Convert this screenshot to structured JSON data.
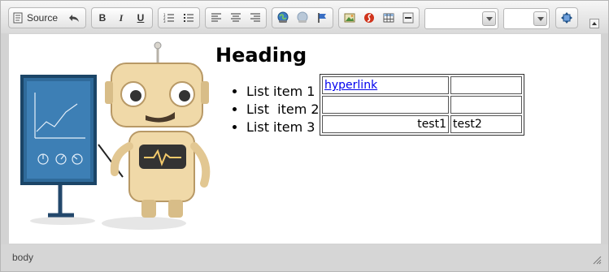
{
  "toolbar": {
    "source_label": "Source",
    "groups": [
      {
        "name": "document",
        "items": [
          "source-icon",
          "undo-icon"
        ]
      },
      {
        "name": "basic-styles",
        "items": [
          "bold-icon",
          "italic-icon",
          "underline-icon"
        ]
      },
      {
        "name": "lists",
        "items": [
          "numbered-list-icon",
          "bulleted-list-icon"
        ]
      },
      {
        "name": "align",
        "items": [
          "align-left-icon",
          "align-center-icon",
          "align-right-icon"
        ]
      },
      {
        "name": "links",
        "items": [
          "link-icon",
          "unlink-icon",
          "anchor-icon"
        ]
      },
      {
        "name": "insert",
        "items": [
          "image-icon",
          "flash-icon",
          "table-icon",
          "horizontal-rule-icon"
        ]
      },
      {
        "name": "tools",
        "items": [
          "maximize-icon"
        ]
      }
    ],
    "format_value": "",
    "size_value": ""
  },
  "content": {
    "image_alt": "robot presenting chart",
    "heading": "Heading",
    "list_items": [
      "List item 1",
      "List  item 2",
      "List item 3"
    ],
    "table": {
      "rows": [
        [
          "hyperlink",
          ""
        ],
        [
          "",
          ""
        ],
        [
          "test1",
          "test2"
        ]
      ]
    }
  },
  "statusbar": {
    "path": "body"
  },
  "colors": {
    "toolbar_bg": "#e6e6e6",
    "link": "#0000ee",
    "chalkboard": "#2f6a9a"
  }
}
